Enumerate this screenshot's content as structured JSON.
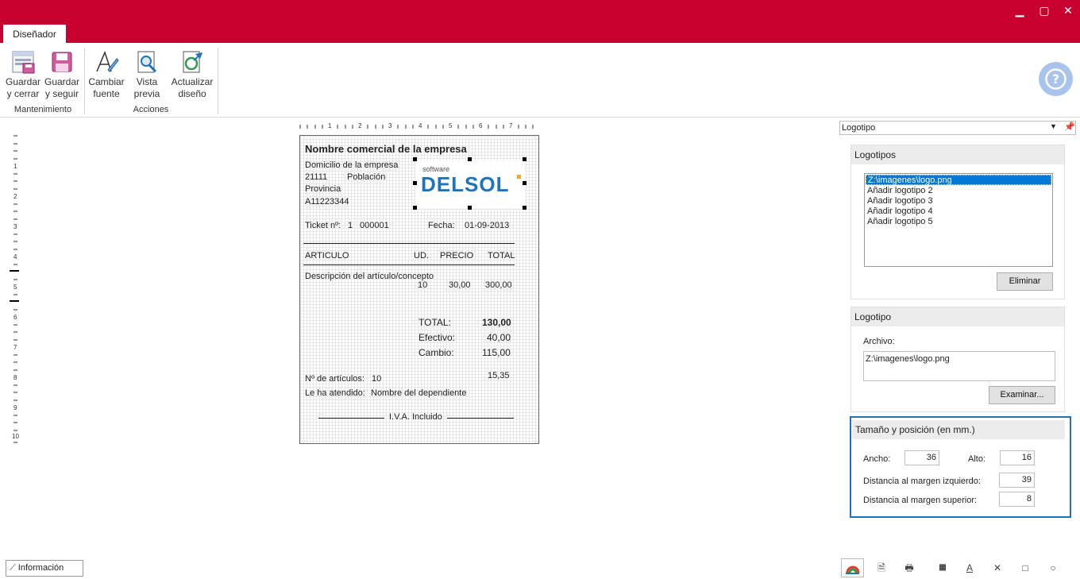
{
  "window": {
    "minimize": "▁",
    "maximize": "▢",
    "close": "✕"
  },
  "ribbon": {
    "tab": "Diseñador",
    "buttons": [
      {
        "line1": "Guardar",
        "line2": "y cerrar"
      },
      {
        "line1": "Guardar",
        "line2": "y seguir"
      },
      {
        "line1": "Cambiar",
        "line2": "fuente"
      },
      {
        "line1": "Vista",
        "line2": "previa"
      },
      {
        "line1": "Actualizar",
        "line2": "diseño"
      }
    ],
    "groups": {
      "mantenimiento": "Mantenimiento",
      "acciones": "Acciones"
    },
    "help": "?"
  },
  "ruler": {
    "top": [
      "1",
      "2",
      "3",
      "4",
      "5",
      "6",
      "7"
    ],
    "left": [
      "1",
      "2",
      "3",
      "4",
      "5",
      "6",
      "7",
      "8",
      "9",
      "10"
    ]
  },
  "ticket": {
    "name": "Nombre  comercial de la empresa",
    "address": "Domicilio de la empresa",
    "postal": "21111",
    "city": "Población",
    "province": "Provincia",
    "taxid": "A11223344",
    "logo_small": "software",
    "logo_big": "DELSOL",
    "ticket_label": "Ticket nº:",
    "ticket_series": "1",
    "ticket_number": "000001",
    "date_label": "Fecha:",
    "date_value": "01-09-2013",
    "col_article": "ARTICULO",
    "col_units": "UD.",
    "col_price": "PRECIO",
    "col_total": "TOTAL",
    "item_desc": "Descripción del artículo/concepto",
    "item_units": "10",
    "item_price": "30,00",
    "item_total": "300,00",
    "total_label": "TOTAL:",
    "total_value": "130,00",
    "cash_label": "Efectivo:",
    "cash_value": "40,00",
    "change_label": "Cambio:",
    "change_value": "115,00",
    "articles_label": "Nº de artículos:",
    "articles_value": "10",
    "tax_value": "15,35",
    "attended_label": "Le ha atendido:",
    "attended_value": "Nombre del dependiente",
    "footer": "I.V.A. Incluido"
  },
  "right": {
    "selector": "Logotipo",
    "logos_title": "Logotipos",
    "logos": [
      "Z:\\imagenes\\logo.png",
      "Añadir logotipo 2",
      "Añadir logotipo 3",
      "Añadir logotipo 4",
      "Añadir logotipo 5"
    ],
    "delete": "Eliminar",
    "logo_title": "Logotipo",
    "file_label": "Archivo:",
    "file_value": "Z:\\imagenes\\logo.png",
    "browse": "Examinar...",
    "size_title": "Tamaño y posición (en mm.)",
    "width_label": "Ancho:",
    "width_value": "36",
    "height_label": "Alto:",
    "height_value": "16",
    "left_label": "Distancia al margen izquierdo:",
    "left_value": "39",
    "top_label": "Distancia al margen superior:",
    "top_value": "8"
  },
  "status": {
    "info": "Información"
  },
  "colors": {
    "titlebar": "#c8002d",
    "accent": "#0078d7",
    "help": "#a8c4ec",
    "logo_blue": "#1e73be",
    "logo_orange": "#f5a623"
  }
}
